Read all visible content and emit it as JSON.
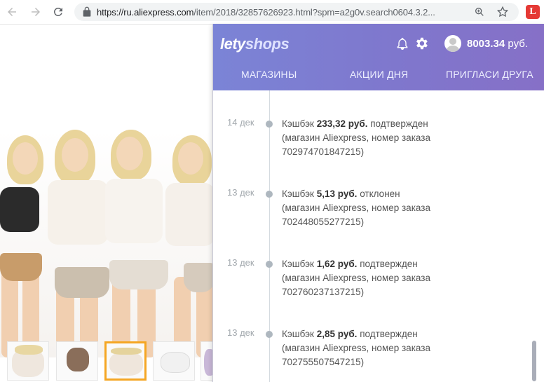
{
  "browser": {
    "url_main": "https://ru.aliexpress.com",
    "url_rest": "/item/2018/32857626923.html?spm=a2g0v.search0604.3.2...",
    "icons": {
      "back": "arrow-left-icon",
      "forward": "arrow-right-icon",
      "reload": "reload-icon",
      "lock": "lock-icon",
      "zoom": "zoom-icon",
      "star": "star-icon",
      "extension": "letyshops-extension-icon"
    },
    "extension_letter": "L"
  },
  "popup": {
    "logo_part1": "lety",
    "logo_part2": "shops",
    "balance_amount": "8003.34",
    "balance_currency": "руб.",
    "tabs": [
      {
        "label": "МАГАЗИНЫ"
      },
      {
        "label": "АКЦИИ ДНЯ"
      },
      {
        "label": "ПРИГЛАСИ ДРУГА"
      }
    ],
    "entries": [
      {
        "date": "14 дек",
        "prefix": "Кэшбэк",
        "amount": "233,32 руб.",
        "status": "подтвержден",
        "line2": "(магазин Aliexpress, номер заказа",
        "line3": "702974701847215)"
      },
      {
        "date": "13 дек",
        "prefix": "Кэшбэк",
        "amount": "5,13 руб.",
        "status": "отклонен",
        "line2": "(магазин Aliexpress, номер заказа",
        "line3": "702448055277215)"
      },
      {
        "date": "13 дек",
        "prefix": "Кэшбэк",
        "amount": "1,62 руб.",
        "status": "подтвержден",
        "line2": "(магазин Aliexpress, номер заказа",
        "line3": "702760237137215)"
      },
      {
        "date": "13 дек",
        "prefix": "Кэшбэк",
        "amount": "2,85 руб.",
        "status": "подтвержден",
        "line2": "(магазин Aliexpress, номер заказа",
        "line3": "702755507547215)"
      }
    ]
  },
  "colors": {
    "header_start": "#7b84d6",
    "header_end": "#8670c7",
    "thumb_active": "#f5a623",
    "extension": "#e53935"
  }
}
